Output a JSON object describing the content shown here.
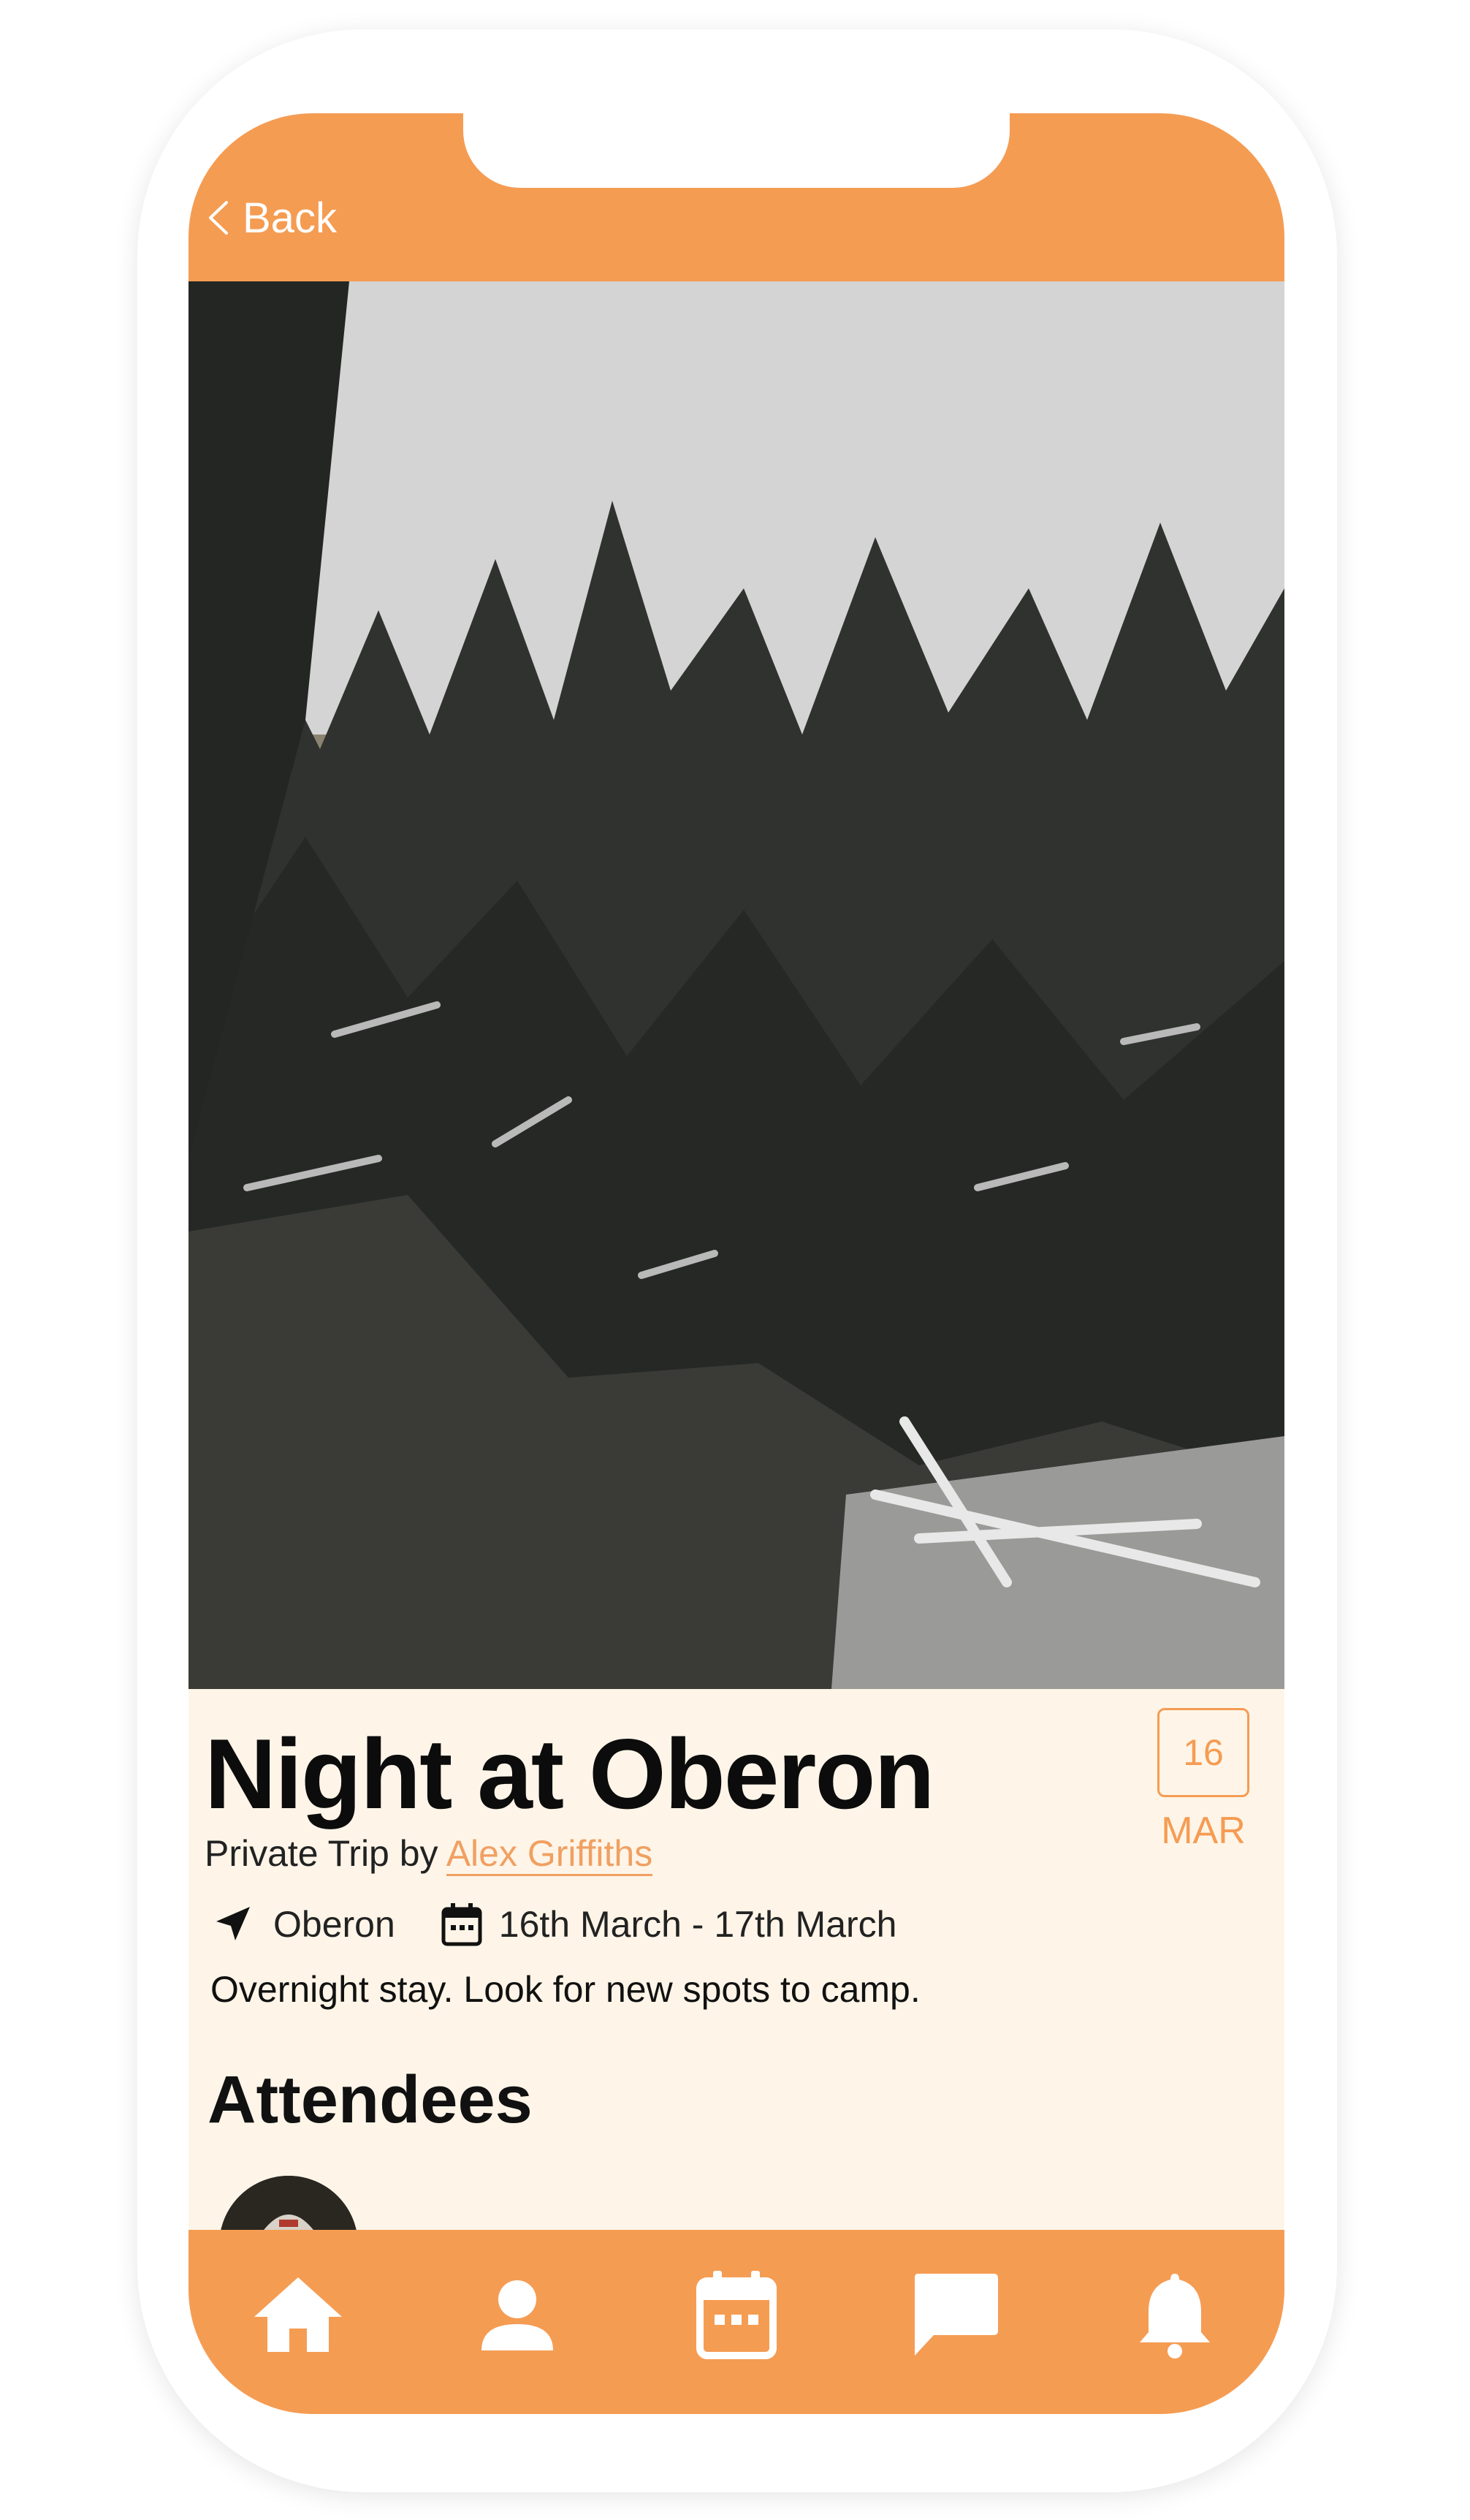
{
  "colors": {
    "accent": "#f59c53",
    "content_background": "#fef5e8",
    "link": "#f0a062",
    "text": "#111111"
  },
  "header": {
    "back_label": "Back",
    "back_icon": "chevron-left-icon"
  },
  "trip": {
    "title": "Night at Oberon",
    "type_prefix": "Private Trip by",
    "organizer": "Alex Griffiths",
    "date_badge": {
      "day": "16",
      "month": "MAR"
    },
    "location": "Oberon",
    "location_icon": "navigation-arrow-icon",
    "date_range": "16th March - 17th March",
    "date_icon": "calendar-icon",
    "description": "Overnight stay. Look for new spots to camp.",
    "hero_image": "photo of snow-dusted pine forest"
  },
  "attendees": {
    "heading": "Attendees",
    "count_visible": 1
  },
  "bottom_nav": {
    "items": [
      {
        "icon": "home-icon"
      },
      {
        "icon": "profile-icon"
      },
      {
        "icon": "calendar-icon"
      },
      {
        "icon": "chat-icon"
      },
      {
        "icon": "bell-icon"
      }
    ]
  }
}
